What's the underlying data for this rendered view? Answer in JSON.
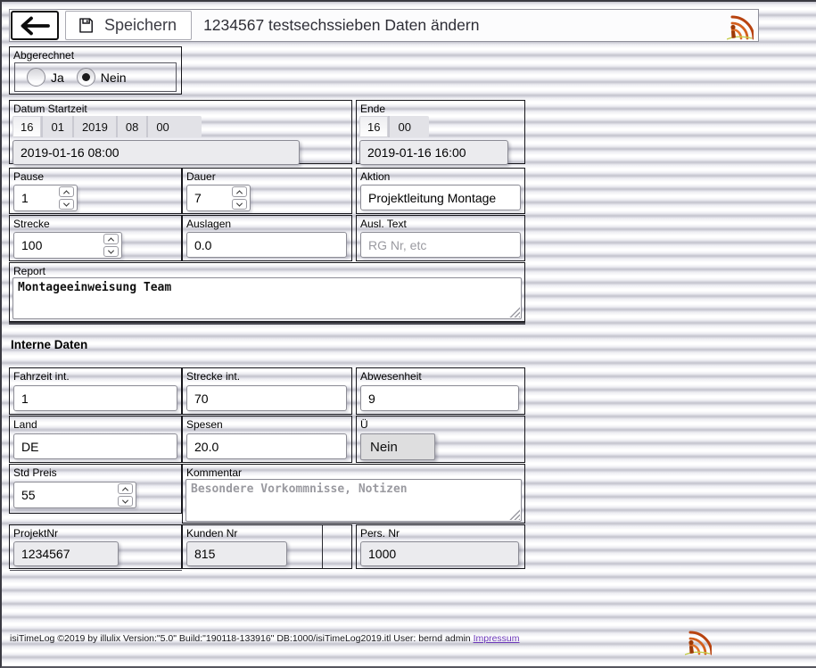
{
  "header": {
    "save_label": "Speichern",
    "title": "1234567 testsechssieben Daten ändern"
  },
  "sections": {
    "abgerechnet": {
      "label": "Abgerechnet",
      "options": [
        {
          "label": "Ja",
          "checked": false
        },
        {
          "label": "Nein",
          "checked": true
        }
      ]
    },
    "start": {
      "label": "Datum Startzeit",
      "segments": [
        "16",
        "01",
        "2019",
        "08",
        "00"
      ],
      "value": "2019-01-16 08:00"
    },
    "ende": {
      "label": "Ende",
      "segments": [
        "16",
        "00"
      ],
      "value": "2019-01-16 16:00"
    },
    "pause": {
      "label": "Pause",
      "value": "1"
    },
    "dauer": {
      "label": "Dauer",
      "value": "7"
    },
    "aktion": {
      "label": "Aktion",
      "value": "Projektleitung Montage"
    },
    "strecke": {
      "label": "Strecke",
      "value": "100"
    },
    "auslagen": {
      "label": "Auslagen",
      "value": "0.0"
    },
    "ausl_text": {
      "label": "Ausl. Text",
      "placeholder": "RG Nr, etc"
    },
    "report": {
      "label": "Report",
      "value": "Montageeinweisung Team"
    },
    "interne_heading": "Interne Daten",
    "fahrzeit": {
      "label": "Fahrzeit int.",
      "value": "1"
    },
    "strecke_int": {
      "label": "Strecke int.",
      "value": "70"
    },
    "abwesenheit": {
      "label": "Abwesenheit",
      "value": "9"
    },
    "land": {
      "label": "Land",
      "value": "DE"
    },
    "spesen": {
      "label": "Spesen",
      "value": "20.0"
    },
    "ue": {
      "label": "Ü",
      "button_label": "Nein"
    },
    "std_preis": {
      "label": "Std Preis",
      "value": "55"
    },
    "kommentar": {
      "label": "Kommentar",
      "placeholder": "Besondere Vorkommnisse, Notizen"
    },
    "projektnr": {
      "label": "ProjektNr",
      "value": "1234567"
    },
    "kundennr": {
      "label": "Kunden Nr",
      "value": "815"
    },
    "persnr": {
      "label": "Pers. Nr",
      "value": "1000"
    }
  },
  "footer": {
    "info": "isiTimeLog ©2019 by illulix Version:\"5.0\" Build:\"190118-133916\" DB:1000/isiTimeLog2019.itl User: bernd admin",
    "link": "Impressum"
  },
  "colors": {
    "logo_orange": "#c9571d",
    "link_purple": "#6a35b8"
  }
}
